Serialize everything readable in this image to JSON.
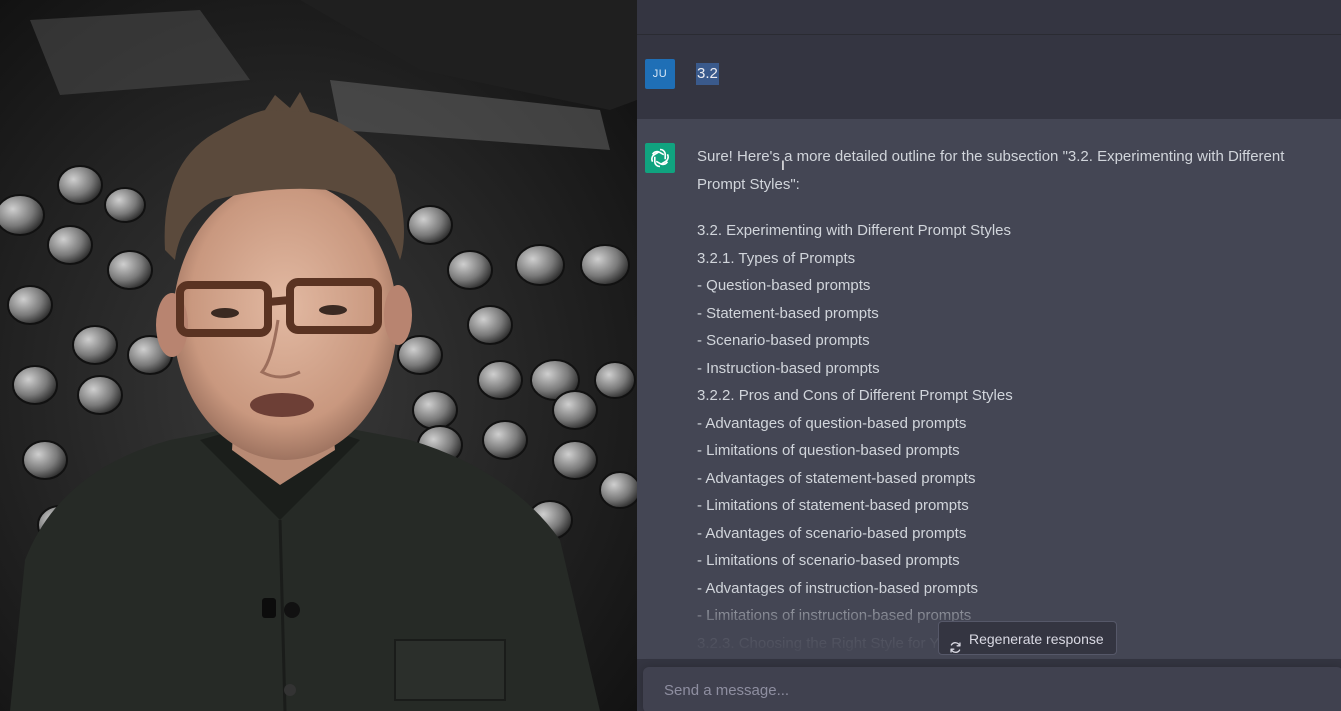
{
  "user_message": {
    "avatar_initials": "JU",
    "text": "3.2"
  },
  "assistant_message": {
    "intro": "Sure! Here's a more detailed outline for the subsection \"3.2. Experimenting with Different Prompt Styles\":",
    "lines": [
      "3.2. Experimenting with Different Prompt Styles",
      "3.2.1. Types of Prompts",
      "- Question-based prompts",
      "- Statement-based prompts",
      "- Scenario-based prompts",
      "- Instruction-based prompts",
      "3.2.2. Pros and Cons of Different Prompt Styles",
      "- Advantages of question-based prompts",
      "- Limitations of question-based prompts",
      "- Advantages of statement-based prompts",
      "- Limitations of statement-based prompts",
      "- Advantages of scenario-based prompts",
      "- Limitations of scenario-based prompts",
      "- Advantages of instruction-based prompts",
      "- Limitations of instruction-based prompts",
      "3.2.3. Choosing the Right Style for Y"
    ]
  },
  "regenerate_label": "Regenerate response",
  "composer": {
    "placeholder": "Send a message..."
  },
  "colors": {
    "user_avatar": "#1f6fb6",
    "bot_avatar": "#10a37f",
    "chat_bg": "#444654",
    "user_row_bg": "#343541"
  }
}
